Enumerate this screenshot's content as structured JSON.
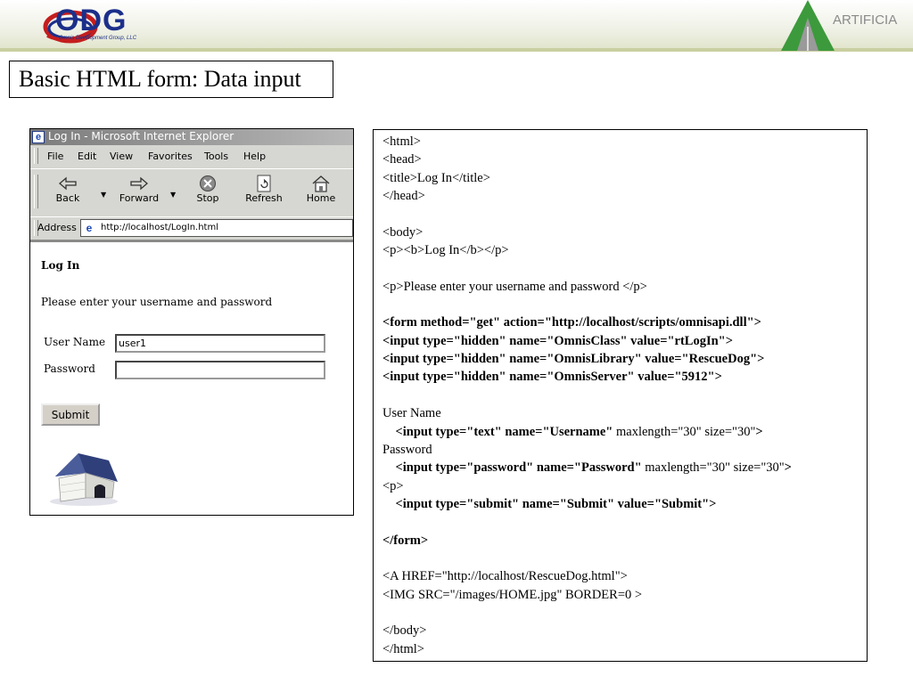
{
  "header": {
    "logo_text": "ODG",
    "logo_subtitle": "Omnis Development Group, LLC",
    "right_logo_text": "ARTIFICIA"
  },
  "slide_title": "Basic HTML form: Data input",
  "browser": {
    "title": "Log In - Microsoft Internet Explorer",
    "menu": [
      "File",
      "Edit",
      "View",
      "Favorites",
      "Tools",
      "Help"
    ],
    "toolbar": [
      "Back",
      "Forward",
      "Stop",
      "Refresh",
      "Home"
    ],
    "address_label": "Address",
    "address_url": "http://localhost/LogIn.html",
    "page": {
      "heading": "Log In",
      "instructions": "Please enter your username and password",
      "username_label": "User Name",
      "username_value": "user1",
      "password_label": "Password",
      "password_value": "",
      "submit_label": "Submit"
    }
  },
  "code_lines": [
    [
      {
        "t": "<html>",
        "b": false
      }
    ],
    [
      {
        "t": "<head>",
        "b": false
      }
    ],
    [
      {
        "t": "<title>Log In</title>",
        "b": false
      }
    ],
    [
      {
        "t": "</head>",
        "b": false
      }
    ],
    [],
    [
      {
        "t": "<body>",
        "b": false
      }
    ],
    [
      {
        "t": "<p><b>Log In</b></p>",
        "b": false
      }
    ],
    [],
    [
      {
        "t": "<p>Please enter your username and password </p>",
        "b": false
      }
    ],
    [],
    [
      {
        "t": "<form method=\"get\" action=\"http://localhost/scripts/omnisapi.dll\">",
        "b": true
      }
    ],
    [
      {
        "t": "<input type=\"hidden\" name=\"OmnisClass\" value=\"rtLogIn\">",
        "b": true
      }
    ],
    [
      {
        "t": "<input type=\"hidden\" name=\"OmnisLibrary\" value=\"RescueDog\">",
        "b": true
      }
    ],
    [
      {
        "t": "<input type=\"hidden\" name=\"OmnisServer\" value=\"5912\">",
        "b": true
      }
    ],
    [],
    [
      {
        "t": "User Name",
        "b": false
      }
    ],
    [
      {
        "t": "    <input type=\"text\" name=\"Username\"",
        "b": true
      },
      {
        "t": " maxlength=\"30\" size=\"30\"",
        "b": false
      },
      {
        "t": ">",
        "b": true
      }
    ],
    [
      {
        "t": "Password",
        "b": false
      }
    ],
    [
      {
        "t": "    <input type=\"password\" name=\"Password\"",
        "b": true
      },
      {
        "t": " maxlength=\"30\" size=\"30\"",
        "b": false
      },
      {
        "t": ">",
        "b": true
      }
    ],
    [
      {
        "t": "<p>",
        "b": false
      }
    ],
    [
      {
        "t": "    <input type=\"submit\" name=\"Submit\" value=\"Submit\">",
        "b": true
      }
    ],
    [],
    [
      {
        "t": "</form>",
        "b": true
      }
    ],
    [],
    [
      {
        "t": "<A HREF=\"http://localhost/RescueDog.html\">",
        "b": false
      }
    ],
    [
      {
        "t": "<IMG SRC=\"/images/HOME.jpg\" BORDER=0 >",
        "b": false
      }
    ],
    [],
    [
      {
        "t": "</body>",
        "b": false
      }
    ],
    [
      {
        "t": "</html>",
        "b": false
      }
    ]
  ]
}
